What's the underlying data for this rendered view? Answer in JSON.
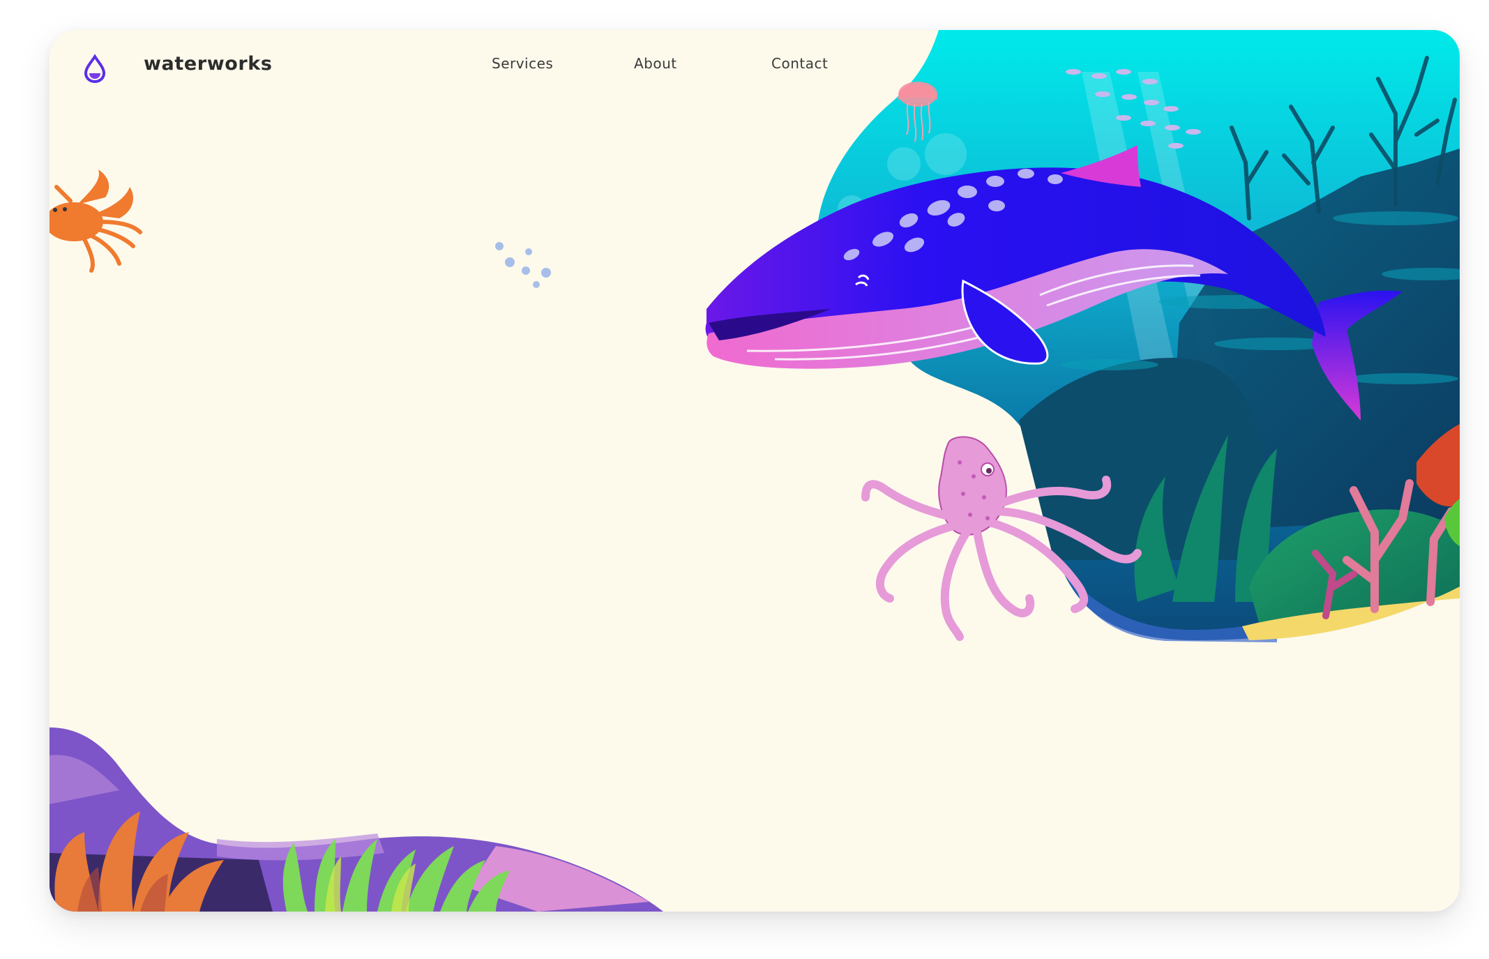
{
  "header": {
    "logo_icon": "water-drop-icon",
    "brand": "waterworks",
    "nav": [
      {
        "label": "Services"
      },
      {
        "label": "About"
      },
      {
        "label": "Contact"
      }
    ]
  },
  "illustration": {
    "subjects": [
      "whale-icon",
      "octopus-icon",
      "crab-icon",
      "jellyfish-icon",
      "fish-school-icon",
      "coral-reef"
    ]
  },
  "colors": {
    "page_bg": "#fdfaec",
    "brand_accent": "#5a2ee8",
    "water_top": "#00e6ea",
    "water_deep": "#0a3b6e",
    "whale_body": "#2510f2",
    "whale_belly": "#f08ad8",
    "octopus": "#e59ad8"
  }
}
